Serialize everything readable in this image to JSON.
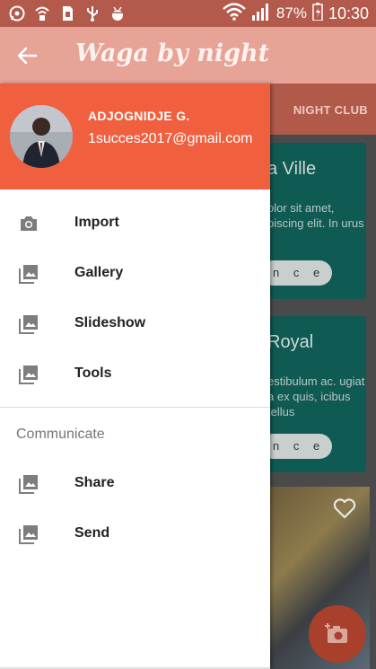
{
  "status_bar": {
    "battery": "87%",
    "time": "10:30",
    "icons": [
      "whatsapp-icon",
      "wifi-lock-icon",
      "sim-icon",
      "usb-icon",
      "android-debug-icon"
    ]
  },
  "toolbar": {
    "title": "Waga by night",
    "back_icon": "arrow-left-icon"
  },
  "background": {
    "tab_label": "NIGHT CLUB",
    "cards": [
      {
        "title": "a Ville",
        "description": "olor sit amet, piscing elit. In urus",
        "button": "n c e"
      },
      {
        "title": "Royal",
        "description": "estibulum ac. ugiat a ex quis, icibus tellus",
        "button": "n c e"
      }
    ]
  },
  "drawer": {
    "user_name": "ADJOGNIDJE G.",
    "user_email": "1succes2017@gmail.com",
    "items": [
      {
        "label": "Import",
        "icon": "camera-icon"
      },
      {
        "label": "Gallery",
        "icon": "gallery-icon"
      },
      {
        "label": "Slideshow",
        "icon": "slideshow-icon"
      },
      {
        "label": "Tools",
        "icon": "tools-icon"
      }
    ],
    "section_title": "Communicate",
    "communicate_items": [
      {
        "label": "Share",
        "icon": "share-icon"
      },
      {
        "label": "Send",
        "icon": "send-icon"
      }
    ]
  },
  "colors": {
    "header": "#f0603f",
    "toolbar": "#e6a396",
    "status_bar": "#b35a4c"
  }
}
